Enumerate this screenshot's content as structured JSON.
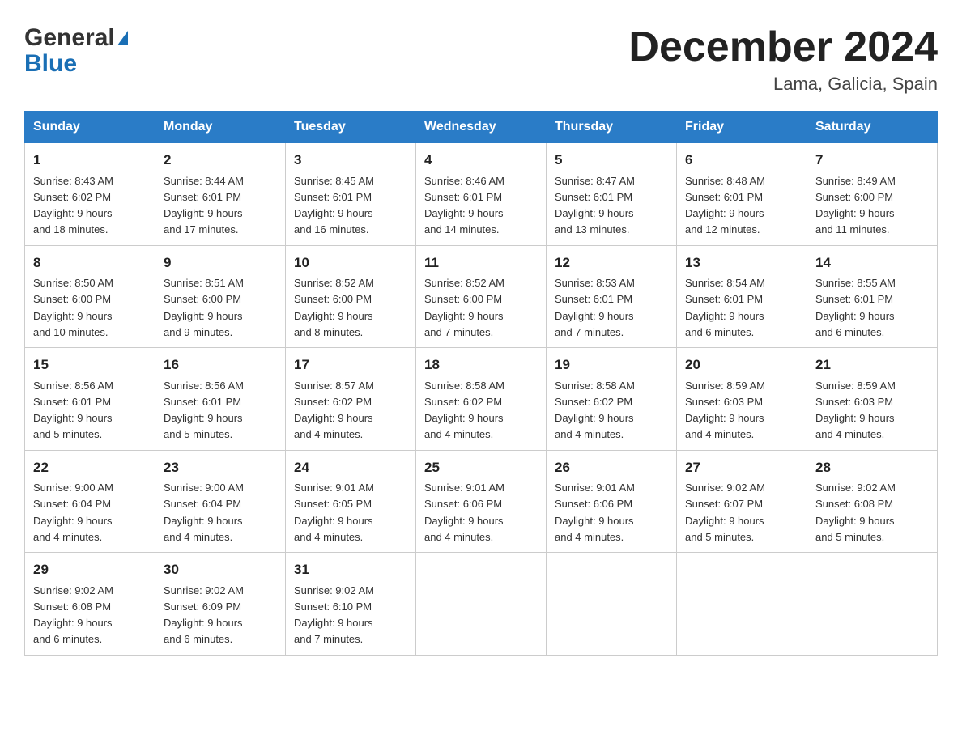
{
  "header": {
    "logo_general": "General",
    "logo_blue": "Blue",
    "month_title": "December 2024",
    "location": "Lama, Galicia, Spain"
  },
  "weekdays": [
    "Sunday",
    "Monday",
    "Tuesday",
    "Wednesday",
    "Thursday",
    "Friday",
    "Saturday"
  ],
  "weeks": [
    [
      {
        "day": "1",
        "sunrise": "8:43 AM",
        "sunset": "6:02 PM",
        "daylight": "9 hours and 18 minutes."
      },
      {
        "day": "2",
        "sunrise": "8:44 AM",
        "sunset": "6:01 PM",
        "daylight": "9 hours and 17 minutes."
      },
      {
        "day": "3",
        "sunrise": "8:45 AM",
        "sunset": "6:01 PM",
        "daylight": "9 hours and 16 minutes."
      },
      {
        "day": "4",
        "sunrise": "8:46 AM",
        "sunset": "6:01 PM",
        "daylight": "9 hours and 14 minutes."
      },
      {
        "day": "5",
        "sunrise": "8:47 AM",
        "sunset": "6:01 PM",
        "daylight": "9 hours and 13 minutes."
      },
      {
        "day": "6",
        "sunrise": "8:48 AM",
        "sunset": "6:01 PM",
        "daylight": "9 hours and 12 minutes."
      },
      {
        "day": "7",
        "sunrise": "8:49 AM",
        "sunset": "6:00 PM",
        "daylight": "9 hours and 11 minutes."
      }
    ],
    [
      {
        "day": "8",
        "sunrise": "8:50 AM",
        "sunset": "6:00 PM",
        "daylight": "9 hours and 10 minutes."
      },
      {
        "day": "9",
        "sunrise": "8:51 AM",
        "sunset": "6:00 PM",
        "daylight": "9 hours and 9 minutes."
      },
      {
        "day": "10",
        "sunrise": "8:52 AM",
        "sunset": "6:00 PM",
        "daylight": "9 hours and 8 minutes."
      },
      {
        "day": "11",
        "sunrise": "8:52 AM",
        "sunset": "6:00 PM",
        "daylight": "9 hours and 7 minutes."
      },
      {
        "day": "12",
        "sunrise": "8:53 AM",
        "sunset": "6:01 PM",
        "daylight": "9 hours and 7 minutes."
      },
      {
        "day": "13",
        "sunrise": "8:54 AM",
        "sunset": "6:01 PM",
        "daylight": "9 hours and 6 minutes."
      },
      {
        "day": "14",
        "sunrise": "8:55 AM",
        "sunset": "6:01 PM",
        "daylight": "9 hours and 6 minutes."
      }
    ],
    [
      {
        "day": "15",
        "sunrise": "8:56 AM",
        "sunset": "6:01 PM",
        "daylight": "9 hours and 5 minutes."
      },
      {
        "day": "16",
        "sunrise": "8:56 AM",
        "sunset": "6:01 PM",
        "daylight": "9 hours and 5 minutes."
      },
      {
        "day": "17",
        "sunrise": "8:57 AM",
        "sunset": "6:02 PM",
        "daylight": "9 hours and 4 minutes."
      },
      {
        "day": "18",
        "sunrise": "8:58 AM",
        "sunset": "6:02 PM",
        "daylight": "9 hours and 4 minutes."
      },
      {
        "day": "19",
        "sunrise": "8:58 AM",
        "sunset": "6:02 PM",
        "daylight": "9 hours and 4 minutes."
      },
      {
        "day": "20",
        "sunrise": "8:59 AM",
        "sunset": "6:03 PM",
        "daylight": "9 hours and 4 minutes."
      },
      {
        "day": "21",
        "sunrise": "8:59 AM",
        "sunset": "6:03 PM",
        "daylight": "9 hours and 4 minutes."
      }
    ],
    [
      {
        "day": "22",
        "sunrise": "9:00 AM",
        "sunset": "6:04 PM",
        "daylight": "9 hours and 4 minutes."
      },
      {
        "day": "23",
        "sunrise": "9:00 AM",
        "sunset": "6:04 PM",
        "daylight": "9 hours and 4 minutes."
      },
      {
        "day": "24",
        "sunrise": "9:01 AM",
        "sunset": "6:05 PM",
        "daylight": "9 hours and 4 minutes."
      },
      {
        "day": "25",
        "sunrise": "9:01 AM",
        "sunset": "6:06 PM",
        "daylight": "9 hours and 4 minutes."
      },
      {
        "day": "26",
        "sunrise": "9:01 AM",
        "sunset": "6:06 PM",
        "daylight": "9 hours and 4 minutes."
      },
      {
        "day": "27",
        "sunrise": "9:02 AM",
        "sunset": "6:07 PM",
        "daylight": "9 hours and 5 minutes."
      },
      {
        "day": "28",
        "sunrise": "9:02 AM",
        "sunset": "6:08 PM",
        "daylight": "9 hours and 5 minutes."
      }
    ],
    [
      {
        "day": "29",
        "sunrise": "9:02 AM",
        "sunset": "6:08 PM",
        "daylight": "9 hours and 6 minutes."
      },
      {
        "day": "30",
        "sunrise": "9:02 AM",
        "sunset": "6:09 PM",
        "daylight": "9 hours and 6 minutes."
      },
      {
        "day": "31",
        "sunrise": "9:02 AM",
        "sunset": "6:10 PM",
        "daylight": "9 hours and 7 minutes."
      },
      null,
      null,
      null,
      null
    ]
  ],
  "labels": {
    "sunrise": "Sunrise:",
    "sunset": "Sunset:",
    "daylight": "Daylight:"
  }
}
